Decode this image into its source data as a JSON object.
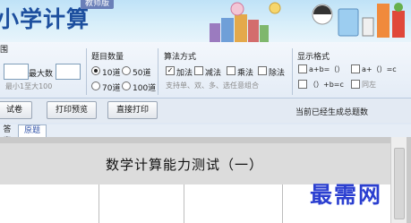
{
  "app": {
    "title": "小学计算",
    "edition": "教师版"
  },
  "range": {
    "group_title": "围",
    "min_value": "",
    "max_label": "最大数",
    "max_value": "",
    "hint": "最小1至大100"
  },
  "count": {
    "group_title": "题目数量",
    "options": [
      "10道",
      "50道",
      "70道",
      "100道"
    ],
    "selected": "10道"
  },
  "method": {
    "group_title": "算法方式",
    "options": [
      {
        "label": "加法",
        "checked": true
      },
      {
        "label": "减法",
        "checked": false
      },
      {
        "label": "乘法",
        "checked": false
      },
      {
        "label": "除法",
        "checked": false
      }
    ],
    "hint": "支持单、双、多、选任意组合"
  },
  "display": {
    "group_title": "显示格式",
    "formats": [
      "a+b=（）",
      "a+（）=c",
      "（）+b=c"
    ],
    "extra": "同左"
  },
  "toolbar": {
    "generate_label": "试卷",
    "preview_label": "打印预览",
    "print_label": "直接打印",
    "status": "当前已经生成总题数"
  },
  "tabs": [
    "答案",
    "原题"
  ],
  "active_tab": "原题",
  "document": {
    "heading": "数学计算能力测试（一）"
  },
  "watermark": "最需网"
}
